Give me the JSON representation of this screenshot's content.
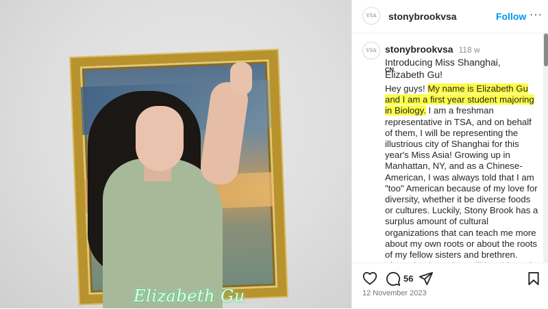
{
  "image": {
    "overlay_name": "Elizabeth Gu"
  },
  "post": {
    "username": "stonybrookvsa",
    "avatar_text": "VSA",
    "follow_label": "Follow",
    "more_label": "···",
    "time_ago": "118 w",
    "caption_title": "Introducing Miss Shanghai, Elizabeth Gu!",
    "caption_tag": "CN",
    "body_intro": "Hey guys! ",
    "body_highlight": "My name is Elizabeth Gu and I am a first year student majoring in Biology.",
    "body_rest": " I am a freshman representative in TSA, and on behalf of them, I will be representing the illustrious city of Shanghai for this year's Miss Asia! Growing up in Manhattan, NY, and as a Chinese-American, I was always told that I am \"too\" American because of my love for diversity, whether it be diverse foods or cultures. Luckily, Stony Brook has a surplus amount of cultural organizations that can teach me more about my own roots or about the roots of my fellow sisters and brethren. Through Miss Asia, I will be able to do so with everyone participating in the pageant, and most",
    "comment_count": "56",
    "date": "12 November 2023"
  },
  "icons": {
    "like": "heart-icon",
    "comment": "comment-icon",
    "share": "paper-plane-icon",
    "save": "bookmark-icon"
  },
  "colors": {
    "follow": "#0095f6",
    "highlight": "#fdfd47"
  }
}
